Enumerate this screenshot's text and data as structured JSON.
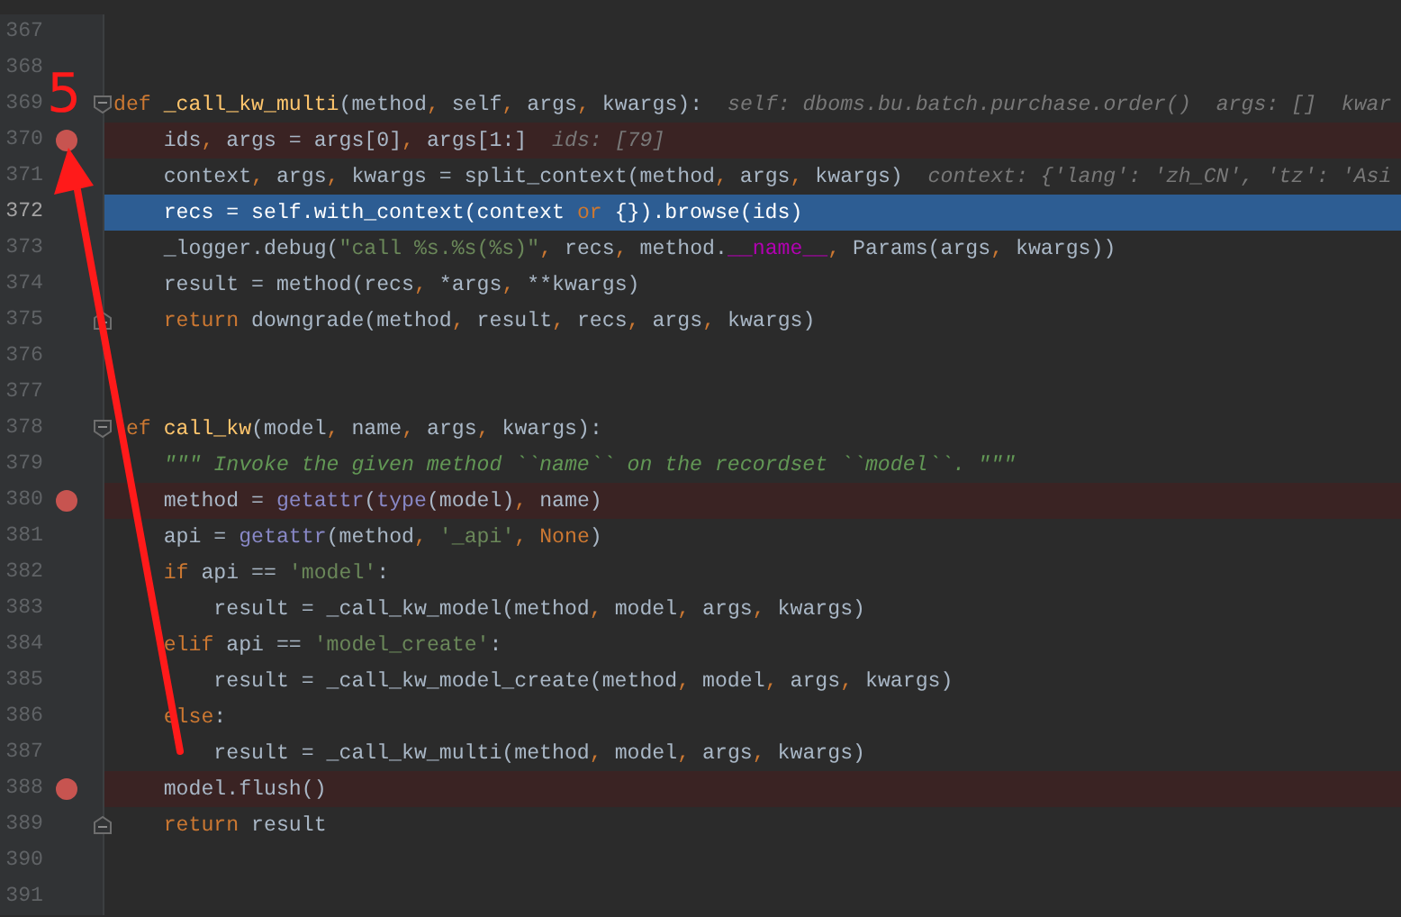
{
  "editor": {
    "lines": [
      {
        "number": "367",
        "breakpoint": false,
        "current": false,
        "fold_start": false,
        "fold_end": false
      },
      {
        "number": "368",
        "breakpoint": false,
        "current": false,
        "fold_start": false,
        "fold_end": false
      },
      {
        "number": "369",
        "breakpoint": false,
        "current": false,
        "fold_start": true,
        "fold_end": false,
        "tokens": [
          {
            "kind": "keyword",
            "text": "def "
          },
          {
            "kind": "function",
            "text": "_call_kw_multi"
          },
          {
            "kind": "plain",
            "text": "(method"
          },
          {
            "kind": "punct",
            "text": ", "
          },
          {
            "kind": "plain",
            "text": "self"
          },
          {
            "kind": "punct",
            "text": ", "
          },
          {
            "kind": "plain",
            "text": "args"
          },
          {
            "kind": "punct",
            "text": ", "
          },
          {
            "kind": "plain",
            "text": "kwargs):"
          }
        ],
        "hint": "self: dboms.bu.batch.purchase.order()  args: []  kwar"
      },
      {
        "number": "370",
        "breakpoint": true,
        "current": false,
        "fold_start": false,
        "fold_end": false,
        "tokens": [
          {
            "kind": "plain",
            "text": "    ids"
          },
          {
            "kind": "punct",
            "text": ", "
          },
          {
            "kind": "plain",
            "text": "args = args[0]"
          },
          {
            "kind": "punct",
            "text": ", "
          },
          {
            "kind": "plain",
            "text": "args[1:]"
          }
        ],
        "hint": "ids: [79]"
      },
      {
        "number": "371",
        "breakpoint": false,
        "current": false,
        "fold_start": false,
        "fold_end": false,
        "tokens": [
          {
            "kind": "plain",
            "text": "    context"
          },
          {
            "kind": "punct",
            "text": ", "
          },
          {
            "kind": "plain",
            "text": "args"
          },
          {
            "kind": "punct",
            "text": ", "
          },
          {
            "kind": "plain",
            "text": "kwargs = split_context(method"
          },
          {
            "kind": "punct",
            "text": ", "
          },
          {
            "kind": "plain",
            "text": "args"
          },
          {
            "kind": "punct",
            "text": ", "
          },
          {
            "kind": "plain",
            "text": "kwargs)"
          }
        ],
        "hint": "context: {'lang': 'zh_CN', 'tz': 'Asi"
      },
      {
        "number": "372",
        "breakpoint": false,
        "current": true,
        "fold_start": false,
        "fold_end": false,
        "tokens": [
          {
            "kind": "plain",
            "text": "    recs = self.with_context(context "
          },
          {
            "kind": "keyword",
            "text": "or"
          },
          {
            "kind": "plain",
            "text": " {}).browse(ids)"
          }
        ]
      },
      {
        "number": "373",
        "breakpoint": false,
        "current": false,
        "fold_start": false,
        "fold_end": false,
        "tokens": [
          {
            "kind": "plain",
            "text": "    _logger.debug("
          },
          {
            "kind": "string",
            "text": "\"call %s.%s(%s)\""
          },
          {
            "kind": "punct",
            "text": ", "
          },
          {
            "kind": "plain",
            "text": "recs"
          },
          {
            "kind": "punct",
            "text": ", "
          },
          {
            "kind": "plain",
            "text": "method."
          },
          {
            "kind": "magic",
            "text": "__name__"
          },
          {
            "kind": "punct",
            "text": ", "
          },
          {
            "kind": "plain",
            "text": "Params(args"
          },
          {
            "kind": "punct",
            "text": ", "
          },
          {
            "kind": "plain",
            "text": "kwargs))"
          }
        ]
      },
      {
        "number": "374",
        "breakpoint": false,
        "current": false,
        "fold_start": false,
        "fold_end": false,
        "tokens": [
          {
            "kind": "plain",
            "text": "    result = method(recs"
          },
          {
            "kind": "punct",
            "text": ", "
          },
          {
            "kind": "plain",
            "text": "*args"
          },
          {
            "kind": "punct",
            "text": ", "
          },
          {
            "kind": "plain",
            "text": "**kwargs)"
          }
        ]
      },
      {
        "number": "375",
        "breakpoint": false,
        "current": false,
        "fold_start": false,
        "fold_end": true,
        "tokens": [
          {
            "kind": "keyword",
            "text": "    return"
          },
          {
            "kind": "plain",
            "text": " downgrade(method"
          },
          {
            "kind": "punct",
            "text": ", "
          },
          {
            "kind": "plain",
            "text": "result"
          },
          {
            "kind": "punct",
            "text": ", "
          },
          {
            "kind": "plain",
            "text": "recs"
          },
          {
            "kind": "punct",
            "text": ", "
          },
          {
            "kind": "plain",
            "text": "args"
          },
          {
            "kind": "punct",
            "text": ", "
          },
          {
            "kind": "plain",
            "text": "kwargs)"
          }
        ]
      },
      {
        "number": "376",
        "breakpoint": false,
        "current": false,
        "fold_start": false,
        "fold_end": false
      },
      {
        "number": "377",
        "breakpoint": false,
        "current": false,
        "fold_start": false,
        "fold_end": false
      },
      {
        "number": "378",
        "breakpoint": false,
        "current": false,
        "fold_start": true,
        "fold_end": false,
        "tokens": [
          {
            "kind": "keyword",
            "text": " ef "
          },
          {
            "kind": "function",
            "text": "call_kw"
          },
          {
            "kind": "plain",
            "text": "(model"
          },
          {
            "kind": "punct",
            "text": ", "
          },
          {
            "kind": "plain",
            "text": "name"
          },
          {
            "kind": "punct",
            "text": ", "
          },
          {
            "kind": "plain",
            "text": "args"
          },
          {
            "kind": "punct",
            "text": ", "
          },
          {
            "kind": "plain",
            "text": "kwargs):"
          }
        ]
      },
      {
        "number": "379",
        "breakpoint": false,
        "current": false,
        "fold_start": false,
        "fold_end": false,
        "tokens": [
          {
            "kind": "docstring",
            "text": "    \"\"\" Invoke the given method ``name`` on the recordset ``model``. \"\"\""
          }
        ]
      },
      {
        "number": "380",
        "breakpoint": true,
        "current": false,
        "fold_start": false,
        "fold_end": false,
        "tokens": [
          {
            "kind": "plain",
            "text": "    method = "
          },
          {
            "kind": "builtin",
            "text": "getattr"
          },
          {
            "kind": "plain",
            "text": "("
          },
          {
            "kind": "builtin",
            "text": "type"
          },
          {
            "kind": "plain",
            "text": "(model)"
          },
          {
            "kind": "punct",
            "text": ", "
          },
          {
            "kind": "plain",
            "text": "name)"
          }
        ]
      },
      {
        "number": "381",
        "breakpoint": false,
        "current": false,
        "fold_start": false,
        "fold_end": false,
        "tokens": [
          {
            "kind": "plain",
            "text": "    api = "
          },
          {
            "kind": "builtin",
            "text": "getattr"
          },
          {
            "kind": "plain",
            "text": "(method"
          },
          {
            "kind": "punct",
            "text": ", "
          },
          {
            "kind": "string",
            "text": "'_api'"
          },
          {
            "kind": "punct",
            "text": ", "
          },
          {
            "kind": "keyword",
            "text": "None"
          },
          {
            "kind": "plain",
            "text": ")"
          }
        ]
      },
      {
        "number": "382",
        "breakpoint": false,
        "current": false,
        "fold_start": false,
        "fold_end": false,
        "tokens": [
          {
            "kind": "keyword",
            "text": "    if"
          },
          {
            "kind": "plain",
            "text": " api == "
          },
          {
            "kind": "string",
            "text": "'model'"
          },
          {
            "kind": "plain",
            "text": ":"
          }
        ]
      },
      {
        "number": "383",
        "breakpoint": false,
        "current": false,
        "fold_start": false,
        "fold_end": false,
        "tokens": [
          {
            "kind": "plain",
            "text": "        result = _call_kw_model(method"
          },
          {
            "kind": "punct",
            "text": ", "
          },
          {
            "kind": "plain",
            "text": "model"
          },
          {
            "kind": "punct",
            "text": ", "
          },
          {
            "kind": "plain",
            "text": "args"
          },
          {
            "kind": "punct",
            "text": ", "
          },
          {
            "kind": "plain",
            "text": "kwargs)"
          }
        ]
      },
      {
        "number": "384",
        "breakpoint": false,
        "current": false,
        "fold_start": false,
        "fold_end": false,
        "tokens": [
          {
            "kind": "keyword",
            "text": "    elif"
          },
          {
            "kind": "plain",
            "text": " api == "
          },
          {
            "kind": "string",
            "text": "'model_create'"
          },
          {
            "kind": "plain",
            "text": ":"
          }
        ]
      },
      {
        "number": "385",
        "breakpoint": false,
        "current": false,
        "fold_start": false,
        "fold_end": false,
        "tokens": [
          {
            "kind": "plain",
            "text": "        result = _call_kw_model_create(method"
          },
          {
            "kind": "punct",
            "text": ", "
          },
          {
            "kind": "plain",
            "text": "model"
          },
          {
            "kind": "punct",
            "text": ", "
          },
          {
            "kind": "plain",
            "text": "args"
          },
          {
            "kind": "punct",
            "text": ", "
          },
          {
            "kind": "plain",
            "text": "kwargs)"
          }
        ]
      },
      {
        "number": "386",
        "breakpoint": false,
        "current": false,
        "fold_start": false,
        "fold_end": false,
        "tokens": [
          {
            "kind": "keyword",
            "text": "    else"
          },
          {
            "kind": "plain",
            "text": ":"
          }
        ]
      },
      {
        "number": "387",
        "breakpoint": false,
        "current": false,
        "fold_start": false,
        "fold_end": false,
        "tokens": [
          {
            "kind": "plain",
            "text": "        result = _call_kw_multi(method"
          },
          {
            "kind": "punct",
            "text": ", "
          },
          {
            "kind": "plain",
            "text": "model"
          },
          {
            "kind": "punct",
            "text": ", "
          },
          {
            "kind": "plain",
            "text": "args"
          },
          {
            "kind": "punct",
            "text": ", "
          },
          {
            "kind": "plain",
            "text": "kwargs)"
          }
        ]
      },
      {
        "number": "388",
        "breakpoint": true,
        "current": false,
        "fold_start": false,
        "fold_end": false,
        "tokens": [
          {
            "kind": "plain",
            "text": "    model.flush()"
          }
        ]
      },
      {
        "number": "389",
        "breakpoint": false,
        "current": false,
        "fold_start": false,
        "fold_end": true,
        "tokens": [
          {
            "kind": "keyword",
            "text": "    return"
          },
          {
            "kind": "plain",
            "text": " result"
          }
        ]
      },
      {
        "number": "390",
        "breakpoint": false,
        "current": false,
        "fold_start": false,
        "fold_end": false
      },
      {
        "number": "391",
        "breakpoint": false,
        "current": false,
        "fold_start": false,
        "fold_end": false
      }
    ]
  },
  "annotation": {
    "label": "5"
  }
}
